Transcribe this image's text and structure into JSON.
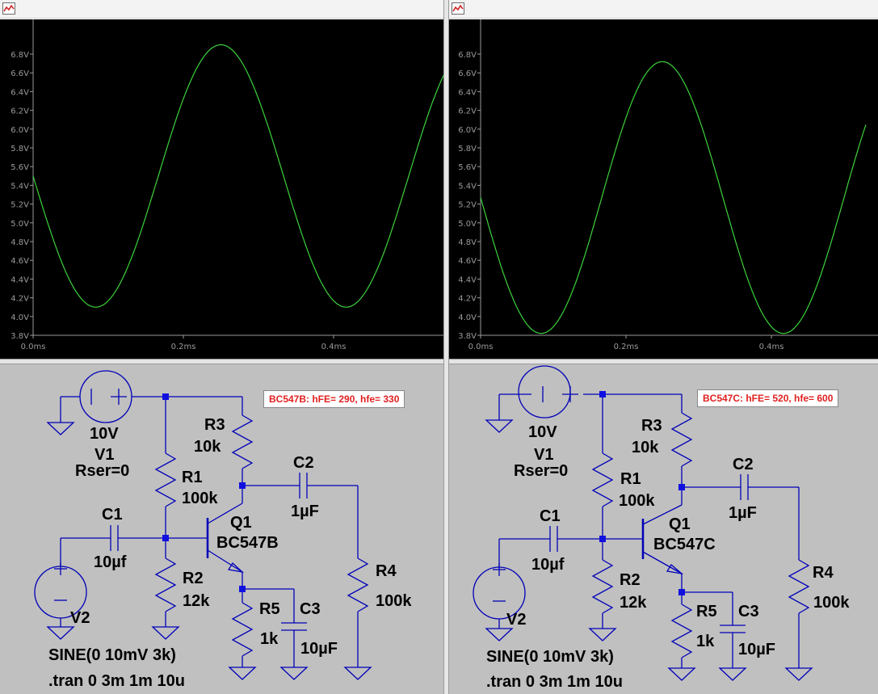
{
  "colors": {
    "trace": "#3cd23c",
    "plot_bg": "#000000",
    "axis": "#9a9a9a",
    "wire": "#0000b8",
    "node": "#1010e0",
    "schematic_bg": "#c0c0c0",
    "comment_text": "#e02020"
  },
  "icons": {
    "window": "waveform-window-icon"
  },
  "panels": [
    {
      "plot": {
        "yticks": [
          "6.8V",
          "6.6V",
          "6.4V",
          "6.2V",
          "6.0V",
          "5.8V",
          "5.6V",
          "5.4V",
          "5.2V",
          "5.0V",
          "4.8V",
          "4.6V",
          "4.4V",
          "4.2V",
          "4.0V",
          "3.8V"
        ],
        "xticks": [
          "0.0ms",
          "0.2ms",
          "0.4ms"
        ],
        "chart_data": {
          "type": "line",
          "ylim": [
            3.8,
            6.95
          ],
          "xlim": [
            0,
            0.55
          ],
          "x_unit": "ms",
          "y_unit": "V",
          "signal": {
            "offset": 5.5,
            "amplitude": 1.4,
            "frequency_khz": 3,
            "phase_deg": 0
          }
        }
      },
      "schematic": {
        "comment": "BC547B: hFE= 290, hfe= 330",
        "v1": {
          "value": "10V",
          "name": "V1",
          "rser": "Rser=0"
        },
        "r1": {
          "name": "R1",
          "value": "100k"
        },
        "r2": {
          "name": "R2",
          "value": "12k"
        },
        "r3": {
          "name": "R3",
          "value": "10k"
        },
        "r4": {
          "name": "R4",
          "value": "100k"
        },
        "r5": {
          "name": "R5",
          "value": "1k"
        },
        "c1": {
          "name": "C1",
          "value": "10µf"
        },
        "c2": {
          "name": "C2",
          "value": "1µF"
        },
        "c3": {
          "name": "C3",
          "value": "10µF"
        },
        "q1": {
          "name": "Q1",
          "model": "BC547B"
        },
        "v2": {
          "name": "V2",
          "source": "SINE(0 10mV 3k)"
        },
        "directive": ".tran 0 3m 1m 10u"
      }
    },
    {
      "plot": {
        "yticks": [
          "6.8V",
          "6.6V",
          "6.4V",
          "6.2V",
          "6.0V",
          "5.8V",
          "5.6V",
          "5.4V",
          "5.2V",
          "5.0V",
          "4.8V",
          "4.6V",
          "4.4V",
          "4.2V",
          "4.0V",
          "3.8V"
        ],
        "xticks": [
          "0.0ms",
          "0.2ms",
          "0.4ms"
        ],
        "chart_data": {
          "type": "line",
          "ylim": [
            3.8,
            6.95
          ],
          "xlim": [
            0,
            0.53
          ],
          "x_unit": "ms",
          "y_unit": "V",
          "signal": {
            "offset": 5.27,
            "amplitude": 1.45,
            "frequency_khz": 3,
            "phase_deg": 0
          }
        }
      },
      "schematic": {
        "comment": "BC547C: hFE= 520, hfe= 600",
        "v1": {
          "value": "10V",
          "name": "V1",
          "rser": "Rser=0"
        },
        "r1": {
          "name": "R1",
          "value": "100k"
        },
        "r2": {
          "name": "R2",
          "value": "12k"
        },
        "r3": {
          "name": "R3",
          "value": "10k"
        },
        "r4": {
          "name": "R4",
          "value": "100k"
        },
        "r5": {
          "name": "R5",
          "value": "1k"
        },
        "c1": {
          "name": "C1",
          "value": "10µf"
        },
        "c2": {
          "name": "C2",
          "value": "1µF"
        },
        "c3": {
          "name": "C3",
          "value": "10µF"
        },
        "q1": {
          "name": "Q1",
          "model": "BC547C"
        },
        "v2": {
          "name": "V2",
          "source": "SINE(0 10mV 3k)"
        },
        "directive": ".tran 0 3m 1m 10u"
      }
    }
  ]
}
